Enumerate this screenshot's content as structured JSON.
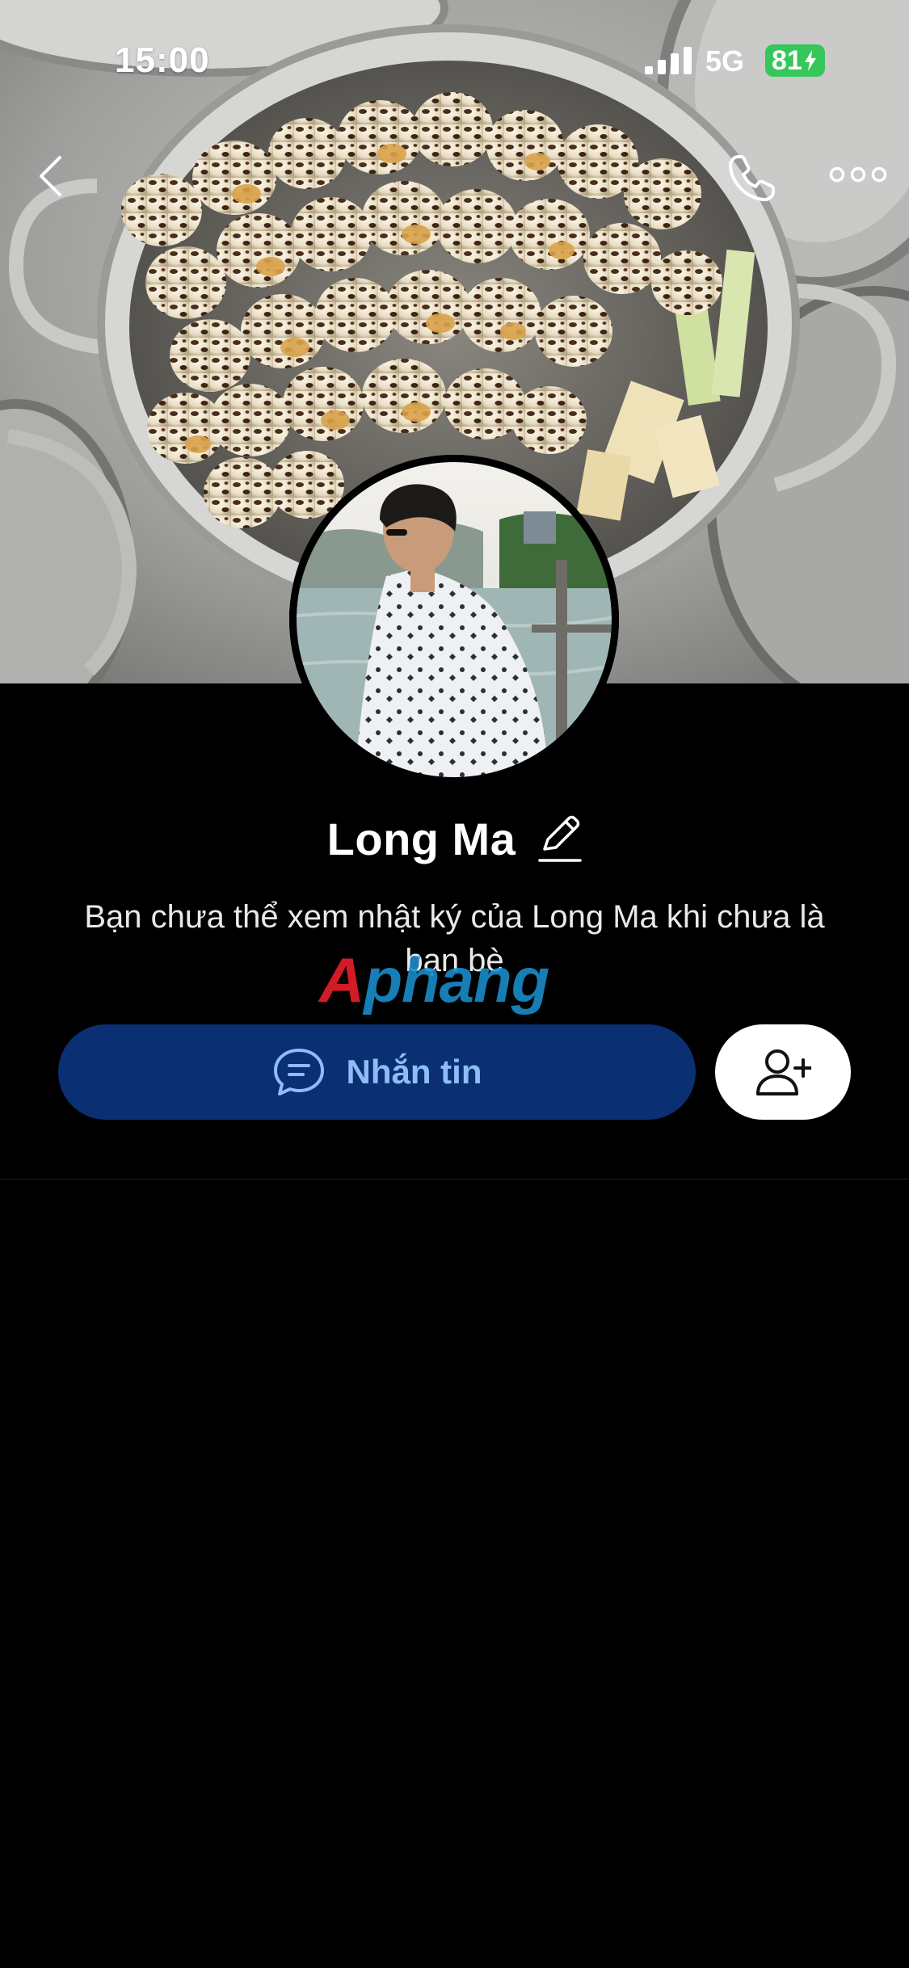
{
  "status_bar": {
    "time": "15:00",
    "network": "5G",
    "battery_level": "81"
  },
  "nav": {
    "back_icon": "chevron-left-icon",
    "call_icon": "phone-icon",
    "more_icon": "ellipsis-icon"
  },
  "profile": {
    "name": "Long Ma",
    "edit_icon": "pencil-icon",
    "notice": "Bạn chưa thể xem nhật ký của Long Ma khi chưa là bạn bè"
  },
  "watermark": {
    "first": "A",
    "rest": "phang"
  },
  "actions": {
    "message_label": "Nhắn tin",
    "message_icon": "chat-bubble-icon",
    "add_friend_icon": "add-user-icon"
  },
  "colors": {
    "background": "#000000",
    "message_button_bg": "#0a2f73",
    "message_button_text": "#8ebdf6",
    "battery_green": "#35c759",
    "add_friend_bg": "#ffffff"
  }
}
